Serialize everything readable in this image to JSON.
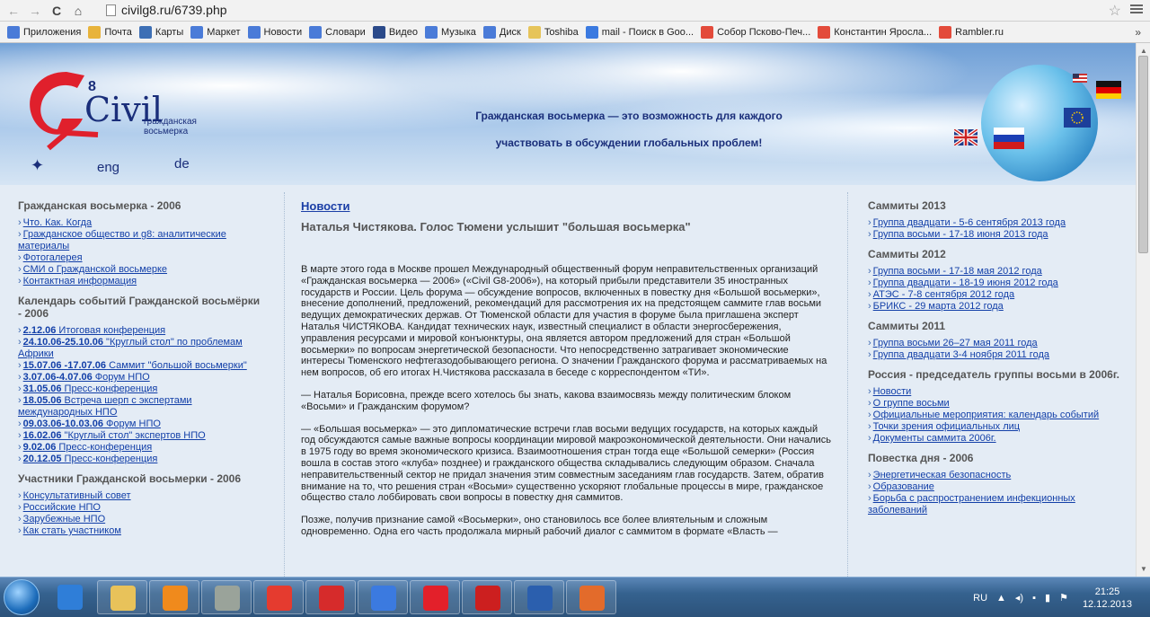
{
  "browser": {
    "url": "civilg8.ru/6739.php",
    "bookmarks": [
      {
        "label": "Приложения",
        "icon": "apps-icon",
        "color": "#4a7bd8"
      },
      {
        "label": "Почта",
        "icon": "mail-icon",
        "color": "#e8b33b"
      },
      {
        "label": "Карты",
        "icon": "maps-icon",
        "color": "#3d6fb5"
      },
      {
        "label": "Маркет",
        "icon": "market-icon",
        "color": "#4a7bd8"
      },
      {
        "label": "Новости",
        "icon": "news-icon",
        "color": "#4a7bd8"
      },
      {
        "label": "Словари",
        "icon": "dictionary-icon",
        "color": "#4a7bd8"
      },
      {
        "label": "Видео",
        "icon": "video-icon",
        "color": "#2b4a8a"
      },
      {
        "label": "Музыка",
        "icon": "music-icon",
        "color": "#4a7bd8"
      },
      {
        "label": "Диск",
        "icon": "disk-icon",
        "color": "#4a7bd8"
      },
      {
        "label": "Toshiba",
        "icon": "folder-icon",
        "color": "#e6c45a"
      },
      {
        "label": "mail - Поиск в Goo...",
        "icon": "google-icon",
        "color": "#3b7ae0"
      },
      {
        "label": "Собор Псково-Печ...",
        "icon": "yandex-icon",
        "color": "#e34b3b"
      },
      {
        "label": "Константин Яросла...",
        "icon": "yandex-icon",
        "color": "#e34b3b"
      },
      {
        "label": "Rambler.ru",
        "icon": "yandex-icon",
        "color": "#e34b3b"
      }
    ],
    "more": "»"
  },
  "header": {
    "logo_text": "Civil",
    "logo_number": "8",
    "logo_sub": "гражданская восьмерка",
    "lang_eng": "eng",
    "lang_de": "de",
    "tagline_line1": "Гражданская восьмерка — это возможность для каждого",
    "tagline_line2": "участвовать в обсуждении глобальных проблем!"
  },
  "left": {
    "section1_title": "Гражданская восьмерка - 2006",
    "section1_links": [
      "Что. Как. Когда",
      "Гражданское общество и g8: аналитические материалы",
      "Фотогалерея",
      "СМИ о Гражданской восьмерке",
      "Контактная информация"
    ],
    "section2_title": "Календарь событий Гражданской восьмёрки - 2006",
    "events": [
      {
        "date": "2.12.06",
        "text": "Итоговая конференция"
      },
      {
        "date": "24.10.06-25.10.06",
        "text": "\"Круглый стол\" по проблемам Африки"
      },
      {
        "date": "15.07.06 -17.07.06",
        "text": "Саммит \"большой восьмерки\""
      },
      {
        "date": "3.07.06-4.07.06",
        "text": "Форум НПО"
      },
      {
        "date": "31.05.06",
        "text": "Пресс-конференция"
      },
      {
        "date": "18.05.06",
        "text": "Встреча шерп с экспертами международных НПО"
      },
      {
        "date": "09.03.06-10.03.06",
        "text": "Форум НПО"
      },
      {
        "date": "16.02.06",
        "text": "\"Круглый стол\" экспертов НПО"
      },
      {
        "date": "9.02.06",
        "text": "Пресс-конференция"
      },
      {
        "date": "20.12.05",
        "text": "Пресс-конференция"
      }
    ],
    "section3_title": "Участники Гражданской восьмерки - 2006",
    "section3_links": [
      "Консультативный совет",
      "Российские НПО",
      "Зарубежные НПО",
      "Как стать участником"
    ]
  },
  "main": {
    "news_heading": "Новости",
    "article_title": "Наталья Чистякова. Голос Тюмени услышит \"большая восьмерка\"",
    "paragraphs": [
      "В марте этого года в Москве прошел Международный общественный форум неправительственных организаций «Гражданская восьмерка — 2006» («Civil G8-2006»), на который прибыли представители 35 иностранных государств и России. Цель форума — обсуждение вопросов, включенных в повестку дня «Большой восьмерки», внесение дополнений, предложений, рекомендаций для рассмотрения их на предстоящем саммите глав восьми ведущих демократических держав. От Тюменской области для участия в форуме была приглашена эксперт Наталья ЧИСТЯКОВА. Кандидат технических наук, известный специалист в области энергосбережения, управления ресурсами и мировой конъюнктуры, она является автором предложений для стран «Большой восьмерки» по вопросам энергетической безопасности. Что непосредственно затрагивает экономические интересы Тюменского нефтегазодобывающего региона. О значении Гражданского форума и рассматриваемых на нем вопросов, об его итогах Н.Чистякова рассказала в беседе с корреспондентом «ТИ».",
      "— Наталья Борисовна, прежде всего хотелось бы знать, какова взаимосвязь между политическим блоком «Восьми» и Гражданским форумом?",
      "— «Большая восьмерка» — это дипломатические встречи глав восьми ведущих государств, на которых каждый год обсуждаются самые важные вопросы координации мировой макроэкономической деятельности. Они начались в 1975 году во время экономического кризиса. Взаимоотношения стран тогда еще «Большой семерки» (Россия вошла в состав этого «клуба» позднее) и гражданского общества складывались следующим образом. Сначала неправительственный сектор не придал значения этим совместным заседаниям глав государств. Затем, обратив внимание на то, что решения стран «Восьми» существенно ускоряют глобальные процессы в мире, гражданское общество стало лоббировать свои вопросы в повестку дня саммитов.",
      "Позже, получив признание самой «Восьмерки», оно становилось все более влиятельным и сложным одновременно. Одна его часть продолжала мирный рабочий диалог с саммитом в формате «Власть —"
    ]
  },
  "right": {
    "groups": [
      {
        "title": "Саммиты 2013",
        "links": [
          "Группа двадцати - 5-6 сентября 2013 года",
          "Группа восьми - 17-18 июня 2013 года"
        ]
      },
      {
        "title": "Саммиты 2012",
        "links": [
          "Группа восьми - 17-18 мая 2012 года",
          "Группа двадцати - 18-19 июня 2012 года",
          "АТЭС - 7-8 сентября 2012 года",
          "БРИКС - 29 марта 2012 года"
        ]
      },
      {
        "title": "Саммиты 2011",
        "links": [
          "Группа восьми 26–27 мая 2011 года",
          "Группа двадцати 3-4 ноября 2011 года"
        ]
      },
      {
        "title": "Россия - председатель группы восьми в 2006г.",
        "links": [
          "Новости",
          "О группе восьми",
          "Официальные мероприятия: календарь событий",
          "Точки зрения официальных лиц",
          "Документы саммита 2006г."
        ]
      },
      {
        "title": "Повестка дня - 2006",
        "links": [
          "Энергетическая безопасность",
          "Образование",
          "Борьба с распространением инфекционных заболеваний"
        ]
      }
    ]
  },
  "taskbar": {
    "apps": [
      "ie-icon",
      "explorer-icon",
      "media-player-icon",
      "camera-icon",
      "chrome-icon",
      "yandex-icon",
      "mail-icon",
      "yandex-browser-icon",
      "kaspersky-icon",
      "word-icon",
      "paint-icon"
    ],
    "lang": "RU",
    "time": "21:25",
    "date": "12.12.2013"
  }
}
